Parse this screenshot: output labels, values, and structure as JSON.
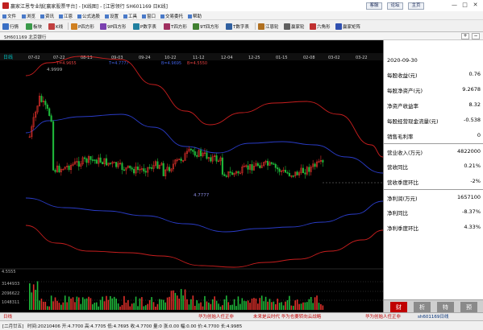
{
  "window": {
    "title": "赢家江恩专业版[赢家股票平台] - [K线图] - [江恩领行 SH601169 日K线]",
    "buttons": [
      "客服",
      "论坛",
      "主页"
    ],
    "controls": [
      "—",
      "□",
      "✕"
    ]
  },
  "menu": [
    "文件",
    "浏览",
    "资讯",
    "江恩",
    "公式选股",
    "设置",
    "工具",
    "窗口",
    "交易委托",
    "帮助"
  ],
  "toolbar": [
    {
      "label": "行情",
      "color": "#3a6fc4"
    },
    {
      "label": "板块",
      "color": "#3a9a4a"
    },
    {
      "label": "K线",
      "color": "#c04040"
    },
    {
      "label": "P四方形",
      "color": "#d08020"
    },
    {
      "label": "9P四方形",
      "color": "#7a40b0"
    },
    {
      "label": "P数字表",
      "color": "#2080a0"
    },
    {
      "label": "T四方形",
      "color": "#a03060"
    },
    {
      "label": "9T四方形",
      "color": "#408030"
    },
    {
      "label": "T数字表",
      "color": "#3060a0"
    },
    {
      "label": "江恩轮",
      "color": "#b07020"
    },
    {
      "label": "赢家轮",
      "color": "#606060"
    },
    {
      "label": "六角形",
      "color": "#c03030"
    },
    {
      "label": "赢家矩阵",
      "color": "#3050b0"
    }
  ],
  "subheader": {
    "title": "SH601169 北京银行",
    "buttons": [
      "+",
      "−"
    ]
  },
  "chart": {
    "x_ticks": [
      "07-02",
      "07-22",
      "08-13",
      "09-03",
      "09-24",
      "10-22",
      "11-12",
      "12-04",
      "12-25",
      "01-15",
      "02-08",
      "03-02",
      "03-22"
    ],
    "price_labels": [
      "4.9999",
      "4.7777",
      "4.5555"
    ],
    "pane_label": "日线",
    "volume_labels": [
      "3144933",
      "2096622",
      "1048311"
    ],
    "top_readouts": [
      "T=4.9655",
      "T=4.7777",
      "B=4.9695",
      "B=4.5550"
    ]
  },
  "info": {
    "date": "2020-09-30",
    "rows": [
      {
        "label": "每股收益(元)",
        "value": "0.76",
        "tone": "normal"
      },
      {
        "label": "每股净资产(元)",
        "value": "9.2678",
        "tone": "normal"
      },
      {
        "label": "净资产收益率",
        "value": "8.32",
        "tone": "normal"
      },
      {
        "label": "每股经营现金流量(元)",
        "value": "-0.538",
        "tone": "normal"
      },
      {
        "label": "销售毛利率",
        "value": "0",
        "tone": "normal"
      },
      {
        "label": "营业收入(万元)",
        "value": "4822000",
        "tone": "normal"
      },
      {
        "label": "营收同比",
        "value": "0.21%",
        "tone": "normal"
      },
      {
        "label": "营收季度环比",
        "value": "-2%",
        "tone": "normal"
      },
      {
        "label": "净利润(万元)",
        "value": "1657100",
        "tone": "normal"
      },
      {
        "label": "净利同比",
        "value": "-8.37%",
        "tone": "normal"
      },
      {
        "label": "净利季度环比",
        "value": "4.33%",
        "tone": "normal"
      }
    ],
    "tabs": [
      "财",
      "析",
      "特",
      "预"
    ]
  },
  "ticker": {
    "tab": "日线",
    "items": [
      "华为创始人任正非",
      "未来是云时代 华为也要转向云战略",
      "华为创始人任正非"
    ],
    "stock_code": "sh601169日线"
  },
  "status": {
    "period": "[二月廿五]",
    "readout": "时间:20210406 开:4.7700 高:4.7705 低:4.7695 收:4.7700 量:0 涨:0.00 幅:0.00 价:4.7700 长:4.9985",
    "extra": "标:4.9985"
  }
}
